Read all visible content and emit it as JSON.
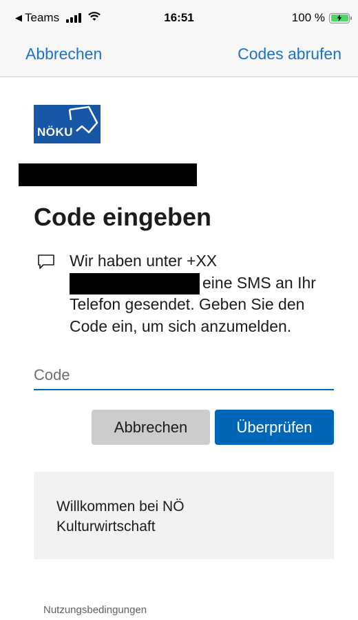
{
  "status_bar": {
    "back_app": "Teams",
    "time": "16:51",
    "battery": "100 %"
  },
  "nav": {
    "cancel_label": "Abbrechen",
    "get_codes_label": "Codes abrufen"
  },
  "logo": {
    "text": "NÖKU",
    "color": "#1856a6"
  },
  "main": {
    "title": "Code eingeben",
    "message_line1": "Wir haben unter +XX",
    "message_line2": "eine SMS an Ihr",
    "message_line3": "Telefon gesendet. Geben Sie den",
    "message_line4": "Code ein, um sich anzumelden.",
    "code_placeholder": "Code",
    "cancel_button": "Abbrechen",
    "verify_button": "Überprüfen"
  },
  "welcome": {
    "text": "Willkommen bei NÖ Kulturwirtschaft"
  },
  "footer": {
    "terms_link": "Nutzungsbedingungen"
  },
  "colors": {
    "accent": "#0067b8",
    "nav_link": "#1a73c8"
  }
}
